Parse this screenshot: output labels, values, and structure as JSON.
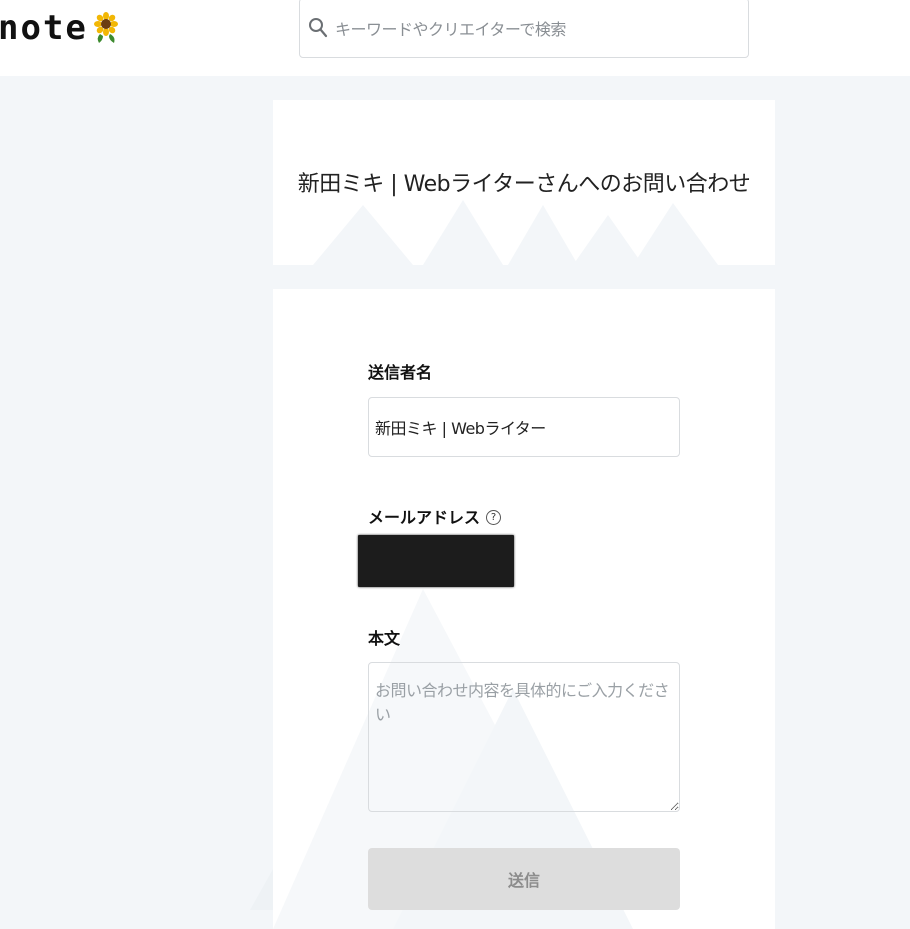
{
  "header": {
    "logo_text": "note",
    "logo_icon": "sunflower-icon",
    "search": {
      "placeholder": "キーワードやクリエイターで検索",
      "icon": "search-icon"
    }
  },
  "page": {
    "title": "新田ミキ | Webライターさんへのお問い合わせ"
  },
  "form": {
    "sender_label": "送信者名",
    "sender_value": "新田ミキ | Webライター",
    "email_label": "メールアドレス",
    "email_help_icon": "help-icon",
    "email_help_glyph": "?",
    "body_label": "本文",
    "body_placeholder": "お問い合わせ内容を具体的にご入力ください",
    "submit_label": "送信"
  },
  "colors": {
    "background": "#f3f6f9",
    "card": "#ffffff",
    "border": "#d9dcdf",
    "button_bg": "#dddddd",
    "button_text": "#8c8c8c",
    "redaction": "#1c1c1c"
  }
}
